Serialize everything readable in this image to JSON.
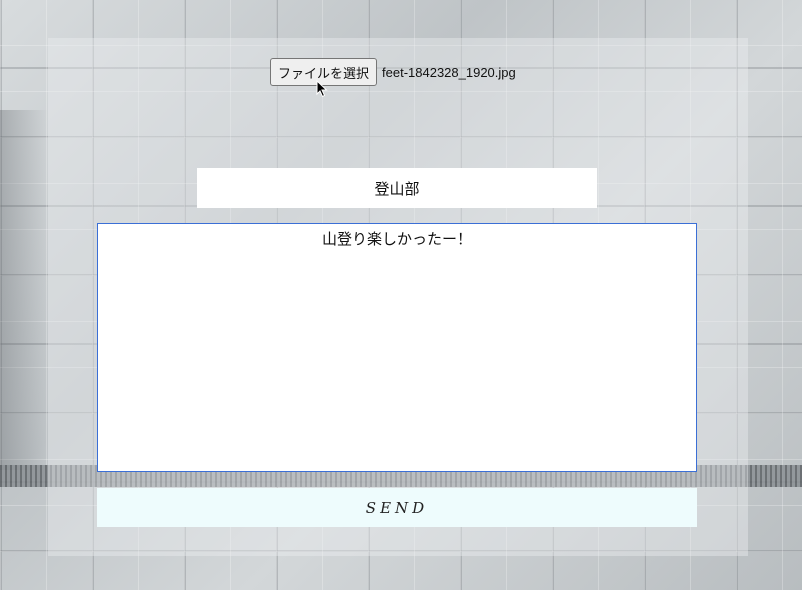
{
  "upload": {
    "button_label": "ファイルを選択",
    "file_name": "feet-1842328_1920.jpg"
  },
  "form": {
    "title_value": "登山部",
    "body_value": "山登り楽しかったー！",
    "send_label": "SEND"
  },
  "colors": {
    "textarea_focus_border": "#3b6fd6",
    "send_button_bg": "#eefcfd"
  }
}
